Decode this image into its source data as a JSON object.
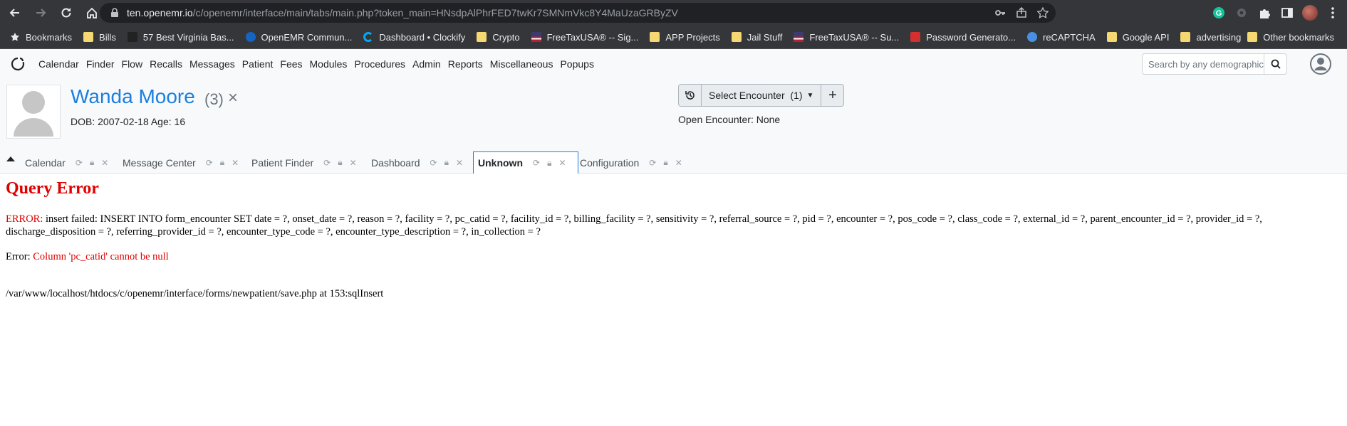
{
  "browser": {
    "url_host": "ten.openemr.io",
    "url_path": "/c/openemr/interface/main/tabs/main.php?token_main=HNsdpAlPhrFED7twKr7SMNmVkc8Y4MaUzaGRByZV"
  },
  "bookmarks": {
    "items": [
      {
        "label": "Bookmarks",
        "icon": "star-icon"
      },
      {
        "label": "Bills",
        "icon": "folder-icon"
      },
      {
        "label": "57 Best Virginia Bas...",
        "icon": "site-icon"
      },
      {
        "label": "OpenEMR Commun...",
        "icon": "site-icon"
      },
      {
        "label": "Dashboard • Clockify",
        "icon": "site-icon"
      },
      {
        "label": "Crypto",
        "icon": "folder-icon"
      },
      {
        "label": "FreeTaxUSA® -- Sig...",
        "icon": "flag-icon"
      },
      {
        "label": "APP Projects",
        "icon": "folder-icon"
      },
      {
        "label": "Jail Stuff",
        "icon": "folder-icon"
      },
      {
        "label": "FreeTaxUSA® -- Su...",
        "icon": "flag-icon"
      },
      {
        "label": "Password Generato...",
        "icon": "site-icon"
      },
      {
        "label": "reCAPTCHA",
        "icon": "site-icon"
      },
      {
        "label": "Google API",
        "icon": "folder-icon"
      },
      {
        "label": "advertising",
        "icon": "folder-icon"
      }
    ],
    "other": "Other bookmarks"
  },
  "menu": {
    "items": [
      "Calendar",
      "Finder",
      "Flow",
      "Recalls",
      "Messages",
      "Patient",
      "Fees",
      "Modules",
      "Procedures",
      "Admin",
      "Reports",
      "Miscellaneous",
      "Popups"
    ],
    "search_placeholder": "Search by any demographics"
  },
  "patient": {
    "name": "Wanda Moore",
    "pid": "(3)",
    "close": "×",
    "dob": "DOB: 2007-02-18 Age: 16"
  },
  "encounter": {
    "select_label": "Select Encounter",
    "count": "(1)",
    "add": "+",
    "open_encounter": "Open Encounter: None"
  },
  "tabs": [
    {
      "label": "Calendar",
      "active": false
    },
    {
      "label": "Message Center",
      "active": false
    },
    {
      "label": "Patient Finder",
      "active": false
    },
    {
      "label": "Dashboard",
      "active": false
    },
    {
      "label": "Unknown",
      "active": true
    },
    {
      "label": "Configuration",
      "active": false
    }
  ],
  "error": {
    "title": "Query Error",
    "error_label": "ERROR:",
    "message": "insert failed: INSERT INTO form_encounter SET date = ?, onset_date = ?, reason = ?, facility = ?, pc_catid = ?, facility_id = ?, billing_facility = ?, sensitivity = ?, referral_source = ?, pid = ?, encounter = ?, pos_code = ?, class_code = ?, external_id = ?, parent_encounter_id = ?, provider_id = ?, discharge_disposition = ?, referring_provider_id = ?, encounter_type_code = ?, encounter_type_description = ?, in_collection = ?",
    "error2_label": "Error:",
    "error2_message": "Column 'pc_catid' cannot be null",
    "path": "/var/www/localhost/htdocs/c/openemr/interface/forms/newpatient/save.php at 153:sqlInsert"
  },
  "colors": {
    "error_red": "#e00000",
    "patient_blue": "#1a7fe0",
    "chrome_dark": "#35363a"
  }
}
